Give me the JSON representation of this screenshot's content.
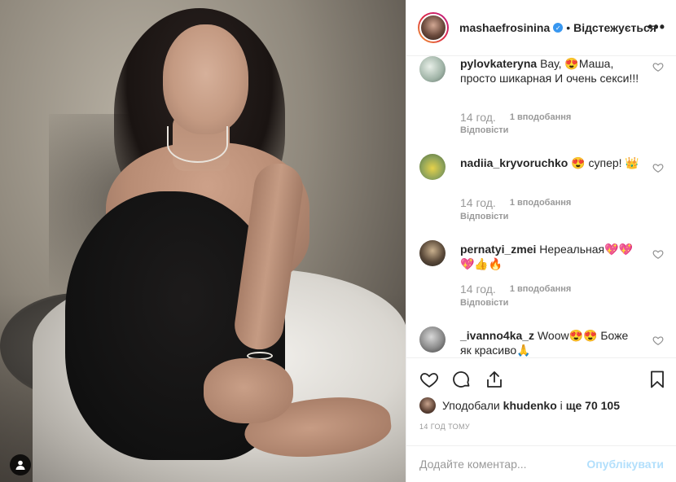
{
  "post": {
    "author": "mashaefrosinina",
    "separator": "•",
    "follow_status": "Відстежується",
    "more_icon": "more-icon"
  },
  "comments": [
    {
      "username": "pylovkateryna",
      "text": "Вау, 😍Маша, просто шикарная И очень секси!!!",
      "time": "14 год.",
      "likes": "1 вподобання",
      "reply": "Відповісти"
    },
    {
      "username": "nadiia_kryvoruchko",
      "text": "😍 супер! 👑",
      "time": "14 год.",
      "likes": "1 вподобання",
      "reply": "Відповісти"
    },
    {
      "username": "pernatyi_zmei",
      "text": "Нереальная💖💖💖👍🔥",
      "time": "14 год.",
      "likes": "1 вподобання",
      "reply": "Відповісти"
    },
    {
      "username": "_ivanno4ka_z",
      "text": "Woow😍😍 Боже як красиво🙏",
      "time": "",
      "likes": "",
      "reply": ""
    }
  ],
  "likes": {
    "prefix": "Уподобали",
    "user": "khudenko",
    "middle": "і",
    "count": "ще 70 105"
  },
  "time_ago": "14 ГОД ТОМУ",
  "comment_box": {
    "placeholder": "Додайте коментар...",
    "publish_label": "Опублікувати"
  },
  "colors": {
    "verified": "#3897f0",
    "publish_disabled": "#b2dffc",
    "muted": "#999999"
  }
}
